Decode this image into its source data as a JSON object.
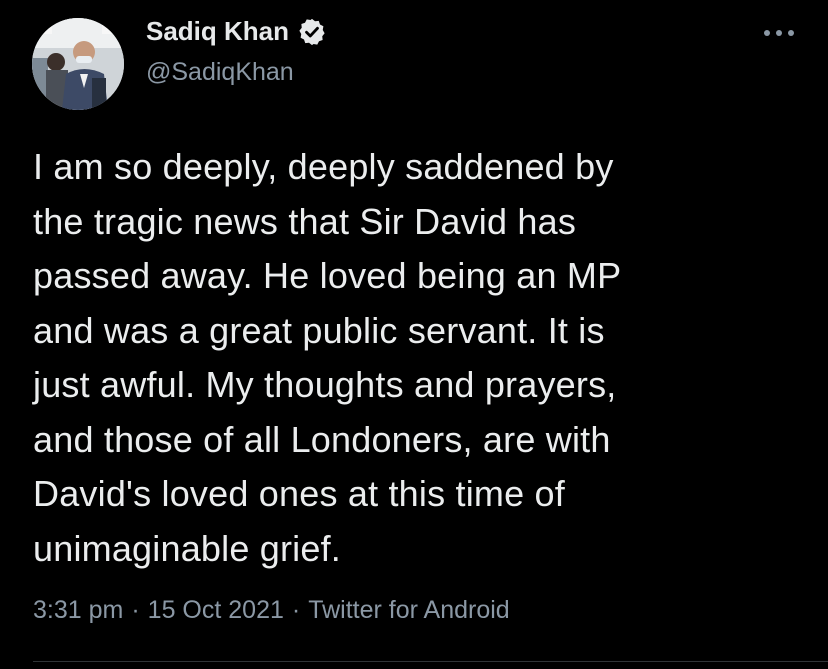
{
  "user": {
    "display_name": "Sadiq Khan",
    "handle": "@SadiqKhan",
    "verified": true,
    "avatar_alt": "Profile photo"
  },
  "tweet": {
    "text_lines": [
      "I am so deeply, deeply saddened by",
      "the tragic news that Sir David has",
      "passed away. He loved being an MP",
      "and was a great public servant. It is",
      "just awful. My thoughts and prayers,",
      "and those of all Londoners, are with",
      "David's loved ones at this time of",
      "unimaginable grief."
    ],
    "time": "3:31 pm",
    "date": "15 Oct 2021",
    "source": "Twitter for Android",
    "separator": "·"
  },
  "icons": {
    "verified": "verified-badge-icon",
    "more": "more-options-icon"
  },
  "colors": {
    "background": "#000000",
    "primary_text": "#e7e9ea",
    "secondary_text": "#8b98a5",
    "divider": "#2f3336"
  }
}
